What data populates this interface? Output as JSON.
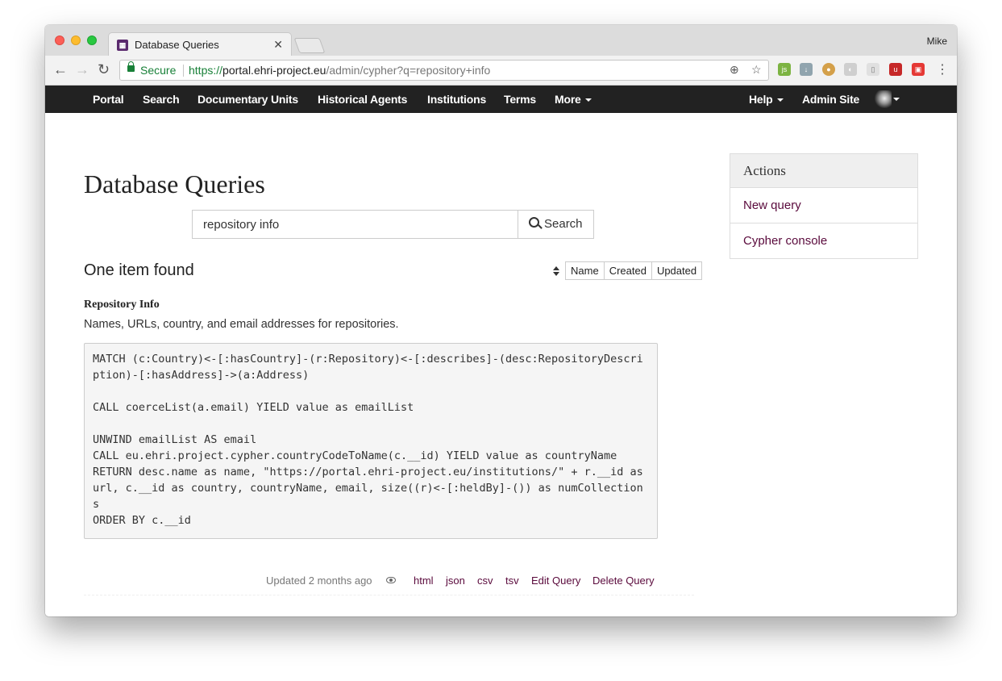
{
  "browser": {
    "tab_title": "Database Queries",
    "profile_name": "Mike",
    "secure_label": "Secure",
    "url_scheme": "https://",
    "url_host": "portal.ehri-project.eu",
    "url_path": "/admin/cypher?q=repository+info"
  },
  "nav": {
    "portal": "Portal",
    "search": "Search",
    "documentary_units": "Documentary Units",
    "historical_agents": "Historical Agents",
    "institutions": "Institutions",
    "terms": "Terms",
    "more": "More",
    "help": "Help",
    "admin_site": "Admin Site"
  },
  "page": {
    "title": "Database Queries",
    "search_value": "repository info",
    "search_button": "Search",
    "results_heading": "One item found",
    "sort_options": [
      "Name",
      "Created",
      "Updated"
    ]
  },
  "item": {
    "title": "Repository Info",
    "description": "Names, URLs, country, and email addresses for repositories.",
    "query": "MATCH (c:Country)<-[:hasCountry]-(r:Repository)<-[:describes]-(desc:RepositoryDescription)-[:hasAddress]->(a:Address)\n\nCALL coerceList(a.email) YIELD value as emailList\n\nUNWIND emailList AS email\nCALL eu.ehri.project.cypher.countryCodeToName(c.__id) YIELD value as countryName\nRETURN desc.name as name, \"https://portal.ehri-project.eu/institutions/\" + r.__id as url, c.__id as country, countryName, email, size((r)<-[:heldBy]-()) as numCollections\nORDER BY c.__id",
    "updated": "Updated 2 months ago",
    "links": {
      "html": "html",
      "json": "json",
      "csv": "csv",
      "tsv": "tsv",
      "edit": "Edit Query",
      "delete": "Delete Query"
    }
  },
  "sidebar": {
    "heading": "Actions",
    "new_query": "New query",
    "cypher_console": "Cypher console"
  },
  "colors": {
    "link": "#5a0a3c",
    "navbar": "#222222",
    "secure_green": "#188038"
  }
}
